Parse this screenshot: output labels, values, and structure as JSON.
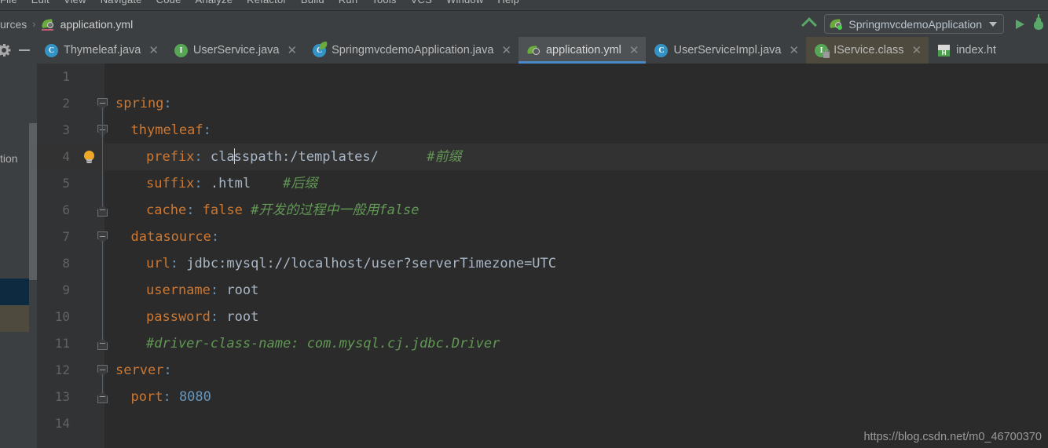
{
  "menu_strip": {
    "items": [
      "File",
      "Edit",
      "View",
      "Navigate",
      "Code",
      "Analyze",
      "Refactor",
      "Build",
      "Run",
      "Tools",
      "VCS",
      "Window",
      "Help"
    ]
  },
  "breadcrumb": {
    "parent": "urces",
    "separator": "›",
    "file": "application.yml",
    "file_icon": "yaml-spring-icon"
  },
  "toolbar": {
    "arrow_up_icon": "arrow-up-icon",
    "run_config_label": "SpringmvcdemoApplication",
    "run_config_icon": "spring-boot-icon",
    "dropdown_icon": "chevron-down-icon",
    "run_icon": "run-play-icon",
    "debug_icon": "debug-bug-icon"
  },
  "tool_cluster": {
    "settings_icon": "gear-icon",
    "hide_icon": "minimize-icon"
  },
  "tabs": [
    {
      "label": "Thymeleaf.java",
      "icon": "java-class-icon",
      "glyph": "C",
      "state": "normal",
      "closable": true
    },
    {
      "label": "UserService.java",
      "icon": "java-interface-icon",
      "glyph": "I",
      "state": "normal",
      "closable": true
    },
    {
      "label": "SpringmvcdemoApplication.java",
      "icon": "spring-boot-class-icon",
      "glyph": "C",
      "state": "normal",
      "closable": true
    },
    {
      "label": "application.yml",
      "icon": "yaml-spring-icon",
      "glyph": "",
      "state": "active",
      "closable": true
    },
    {
      "label": "UserServiceImpl.java",
      "icon": "java-class-icon",
      "glyph": "C",
      "state": "normal",
      "closable": true
    },
    {
      "label": "IService.class",
      "icon": "java-interface-locked-icon",
      "glyph": "I",
      "state": "highlight",
      "closable": true
    },
    {
      "label": "index.ht",
      "icon": "html-file-icon",
      "glyph": "H",
      "state": "normal",
      "closable": false
    }
  ],
  "sidebar": {
    "visible_label": "tion",
    "items": [
      {
        "label": "",
        "state": "normal"
      },
      {
        "label": "tion",
        "state": "normal"
      },
      {
        "label": "",
        "state": "normal"
      },
      {
        "label": "",
        "state": "normal"
      },
      {
        "label": "",
        "state": "normal"
      },
      {
        "label": "",
        "state": "normal"
      },
      {
        "label": "",
        "state": "selected"
      },
      {
        "label": "",
        "state": "highlight"
      },
      {
        "label": "",
        "state": "normal"
      }
    ]
  },
  "editor": {
    "file": "application.yml",
    "caret_line": 4,
    "caret_column": 14,
    "lines": [
      {
        "n": 1,
        "indent": 0,
        "tokens": []
      },
      {
        "n": 2,
        "indent": 0,
        "fold": "down",
        "tokens": [
          {
            "t": "spring",
            "c": "k"
          },
          {
            "t": ":",
            "c": "colon"
          }
        ]
      },
      {
        "n": 3,
        "indent": 1,
        "fold": "down",
        "tokens": [
          {
            "t": "thymeleaf",
            "c": "k"
          },
          {
            "t": ":",
            "c": "colon"
          }
        ]
      },
      {
        "n": 4,
        "indent": 2,
        "bulb": true,
        "current": true,
        "tokens": [
          {
            "t": "prefix",
            "c": "k"
          },
          {
            "t": ": ",
            "c": "colon"
          },
          {
            "t": "cla",
            "c": "val"
          },
          {
            "t": "|CURSOR|",
            "c": "cursor"
          },
          {
            "t": "sspath:/templates/",
            "c": "val"
          },
          {
            "t": "      ",
            "c": "val"
          },
          {
            "t": "#前缀",
            "c": "cm"
          }
        ]
      },
      {
        "n": 5,
        "indent": 2,
        "tokens": [
          {
            "t": "suffix",
            "c": "k"
          },
          {
            "t": ": ",
            "c": "colon"
          },
          {
            "t": ".html",
            "c": "val"
          },
          {
            "t": "    ",
            "c": "val"
          },
          {
            "t": "#后缀",
            "c": "cm"
          }
        ]
      },
      {
        "n": 6,
        "indent": 2,
        "fold": "up",
        "tokens": [
          {
            "t": "cache",
            "c": "k"
          },
          {
            "t": ": ",
            "c": "colon"
          },
          {
            "t": "false",
            "c": "bool"
          },
          {
            "t": " ",
            "c": "val"
          },
          {
            "t": "#开发的过程中一般用false",
            "c": "cm"
          }
        ]
      },
      {
        "n": 7,
        "indent": 1,
        "fold": "down",
        "tokens": [
          {
            "t": "datasource",
            "c": "k"
          },
          {
            "t": ":",
            "c": "colon"
          }
        ]
      },
      {
        "n": 8,
        "indent": 2,
        "tokens": [
          {
            "t": "url",
            "c": "k"
          },
          {
            "t": ": ",
            "c": "colon"
          },
          {
            "t": "jdbc:mysql://localhost/user?serverTimezone=UTC",
            "c": "val"
          }
        ]
      },
      {
        "n": 9,
        "indent": 2,
        "tokens": [
          {
            "t": "username",
            "c": "k"
          },
          {
            "t": ": ",
            "c": "colon"
          },
          {
            "t": "root",
            "c": "val"
          }
        ]
      },
      {
        "n": 10,
        "indent": 2,
        "tokens": [
          {
            "t": "password",
            "c": "k"
          },
          {
            "t": ": ",
            "c": "colon"
          },
          {
            "t": "root",
            "c": "val"
          }
        ]
      },
      {
        "n": 11,
        "indent": 2,
        "fold": "up",
        "tokens": [
          {
            "t": "#driver-class-name: com.mysql.cj.jdbc.Driver",
            "c": "cm"
          }
        ]
      },
      {
        "n": 12,
        "indent": 0,
        "fold": "down",
        "tokens": [
          {
            "t": "server",
            "c": "k"
          },
          {
            "t": ":",
            "c": "colon"
          }
        ]
      },
      {
        "n": 13,
        "indent": 1,
        "fold": "up",
        "tokens": [
          {
            "t": "port",
            "c": "k"
          },
          {
            "t": ": ",
            "c": "colon"
          },
          {
            "t": "8080",
            "c": "num"
          }
        ]
      },
      {
        "n": 14,
        "indent": 0,
        "tokens": []
      }
    ]
  },
  "watermark": "https://blog.csdn.net/m0_46700370",
  "colors": {
    "editor_bg": "#2b2b2b",
    "gutter_bg": "#313335",
    "chrome_bg": "#3c3f41",
    "active_tab_bg": "#4e5254",
    "highlight_tab_bg": "#4e4a3e",
    "tab_underline": "#4a88c7",
    "key_orange": "#cc7832",
    "comment_green": "#629755",
    "number_blue": "#6897bb",
    "text_gray": "#a9b7c6",
    "selected_row": "#0d2a40"
  }
}
